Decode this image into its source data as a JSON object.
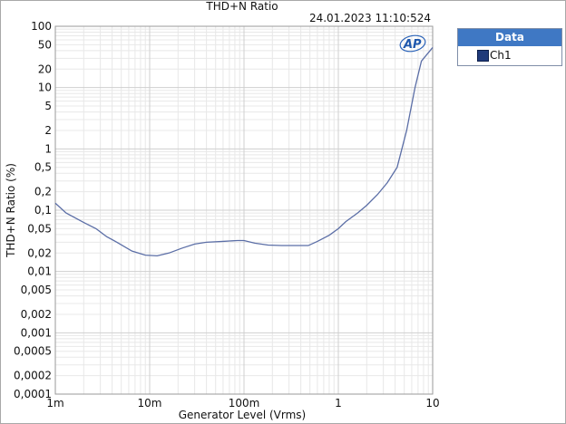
{
  "chart_data": {
    "type": "line",
    "title": "THD+N Ratio",
    "timestamp": "24.01.2023 11:10:524",
    "xlabel": "Generator Level (Vrms)",
    "ylabel": "THD+N Ratio (%)",
    "x_scale": "log",
    "y_scale": "log",
    "xlim": [
      0.001,
      10
    ],
    "ylim": [
      0.0001,
      100
    ],
    "grid": true,
    "legend_title": "Data",
    "legend_placement": "right",
    "logo_text": "AP",
    "colors": {
      "series": "#5b6ea6",
      "legend_header": "#3f78c4",
      "swatch": "#1f3a7a",
      "grid_major": "#cfcfcf",
      "grid_minor": "#e8e8e8"
    },
    "x_ticks": [
      {
        "v": 0.001,
        "label": "1m"
      },
      {
        "v": 0.01,
        "label": "10m"
      },
      {
        "v": 0.1,
        "label": "100m"
      },
      {
        "v": 1,
        "label": "1"
      },
      {
        "v": 10,
        "label": "10"
      }
    ],
    "y_ticks": [
      {
        "v": 100,
        "label": "100"
      },
      {
        "v": 50,
        "label": "50"
      },
      {
        "v": 20,
        "label": "20"
      },
      {
        "v": 10,
        "label": "10"
      },
      {
        "v": 5,
        "label": "5"
      },
      {
        "v": 2,
        "label": "2"
      },
      {
        "v": 1,
        "label": "1"
      },
      {
        "v": 0.5,
        "label": "0,5"
      },
      {
        "v": 0.2,
        "label": "0,2"
      },
      {
        "v": 0.1,
        "label": "0,1"
      },
      {
        "v": 0.05,
        "label": "0,05"
      },
      {
        "v": 0.02,
        "label": "0,02"
      },
      {
        "v": 0.01,
        "label": "0,01"
      },
      {
        "v": 0.005,
        "label": "0,005"
      },
      {
        "v": 0.002,
        "label": "0,002"
      },
      {
        "v": 0.001,
        "label": "0,001"
      },
      {
        "v": 0.0005,
        "label": "0,0005"
      },
      {
        "v": 0.0002,
        "label": "0,0002"
      },
      {
        "v": 0.0001,
        "label": "0,0001"
      }
    ],
    "series": [
      {
        "name": "Ch1",
        "x": [
          0.001,
          0.0013,
          0.002,
          0.0027,
          0.0035,
          0.0045,
          0.0065,
          0.009,
          0.012,
          0.016,
          0.022,
          0.03,
          0.04,
          0.06,
          0.085,
          0.1,
          0.13,
          0.18,
          0.25,
          0.35,
          0.48,
          0.6,
          0.8,
          1.0,
          1.2,
          1.6,
          2.0,
          2.6,
          3.3,
          4.2,
          5.3,
          6.5,
          7.6,
          10
        ],
        "y": [
          0.13,
          0.09,
          0.063,
          0.05,
          0.037,
          0.03,
          0.0215,
          0.0185,
          0.018,
          0.02,
          0.024,
          0.028,
          0.03,
          0.031,
          0.032,
          0.032,
          0.029,
          0.027,
          0.0265,
          0.0265,
          0.0265,
          0.031,
          0.039,
          0.05,
          0.065,
          0.09,
          0.12,
          0.18,
          0.28,
          0.5,
          2.0,
          10,
          27,
          45
        ]
      }
    ]
  }
}
